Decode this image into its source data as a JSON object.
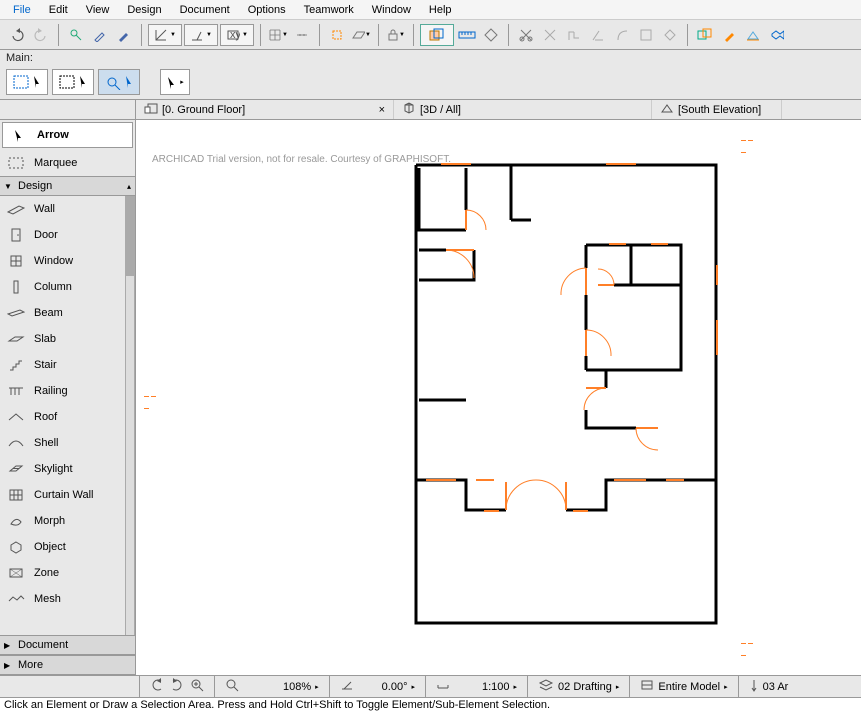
{
  "menu": {
    "file": "File",
    "edit": "Edit",
    "view": "View",
    "design": "Design",
    "document": "Document",
    "options": "Options",
    "teamwork": "Teamwork",
    "window": "Window",
    "help": "Help"
  },
  "main_label": "Main:",
  "tabs": {
    "t1": "[0. Ground Floor]",
    "t2": "[3D / All]",
    "t3": "[South Elevation]"
  },
  "tools": {
    "arrow": "Arrow",
    "marquee": "Marquee",
    "design_hdr": "Design",
    "wall": "Wall",
    "door": "Door",
    "window": "Window",
    "column": "Column",
    "beam": "Beam",
    "slab": "Slab",
    "stair": "Stair",
    "railing": "Railing",
    "roof": "Roof",
    "shell": "Shell",
    "skylight": "Skylight",
    "curtain": "Curtain Wall",
    "morph": "Morph",
    "object": "Object",
    "zone": "Zone",
    "mesh": "Mesh",
    "document_hdr": "Document",
    "more_hdr": "More"
  },
  "watermark": "ARCHICAD Trial version, not for resale. Courtesy of GRAPHISOFT.",
  "bottombar": {
    "zoom": "108%",
    "angle": "0.00°",
    "scale": "1:100",
    "layer": "02 Drafting",
    "model": "Entire Model",
    "extra": "03 Ar"
  },
  "status": "Click an Element or Draw a Selection Area. Press and Hold Ctrl+Shift to Toggle Element/Sub-Element Selection."
}
